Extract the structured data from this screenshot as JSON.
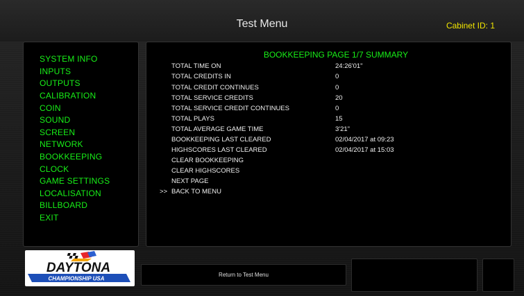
{
  "header": {
    "title": "Test Menu",
    "cabinet_label": "Cabinet ID: 1"
  },
  "sidebar": {
    "items": [
      {
        "label": "SYSTEM INFO"
      },
      {
        "label": "INPUTS"
      },
      {
        "label": "OUTPUTS"
      },
      {
        "label": "CALIBRATION"
      },
      {
        "label": "COIN"
      },
      {
        "label": "SOUND"
      },
      {
        "label": "SCREEN"
      },
      {
        "label": "NETWORK"
      },
      {
        "label": "BOOKKEEPING"
      },
      {
        "label": "CLOCK"
      },
      {
        "label": "GAME SETTINGS"
      },
      {
        "label": "LOCALISATION"
      },
      {
        "label": "BILLBOARD"
      },
      {
        "label": "EXIT"
      }
    ]
  },
  "main": {
    "page_title": "BOOKKEEPING PAGE 1/7 SUMMARY",
    "rows": [
      {
        "label": "TOTAL TIME ON",
        "value": "24:26'01\""
      },
      {
        "label": "TOTAL CREDITS IN",
        "value": "0"
      },
      {
        "label": "TOTAL CREDIT CONTINUES",
        "value": "0"
      },
      {
        "label": "TOTAL SERVICE CREDITS",
        "value": "20"
      },
      {
        "label": "TOTAL SERVICE CREDIT CONTINUES",
        "value": "0"
      },
      {
        "label": "TOTAL PLAYS",
        "value": "15"
      },
      {
        "label": "TOTAL AVERAGE GAME TIME",
        "value": "3'21\""
      },
      {
        "label": "BOOKKEEPING LAST CLEARED",
        "value": "02/04/2017 at 09:23"
      },
      {
        "label": "HIGHSCORES LAST CLEARED",
        "value": "02/04/2017 at 15:03"
      }
    ],
    "actions": [
      {
        "label": "CLEAR BOOKKEEPING",
        "cursor": ""
      },
      {
        "label": "CLEAR HIGHSCORES",
        "cursor": ""
      },
      {
        "label": "NEXT PAGE",
        "cursor": ""
      },
      {
        "label": "BACK TO MENU",
        "cursor": ">>"
      }
    ]
  },
  "logo": {
    "brand": "DAYTONA",
    "sub": "CHAMPIONSHIP USA"
  },
  "footer": {
    "return_label": "Return to Test Menu"
  },
  "colors": {
    "menu_green": "#18f018",
    "cabinet_yellow": "#f2e600",
    "text_white": "#f0f0f0",
    "logo_blue": "#1d4fb8"
  }
}
